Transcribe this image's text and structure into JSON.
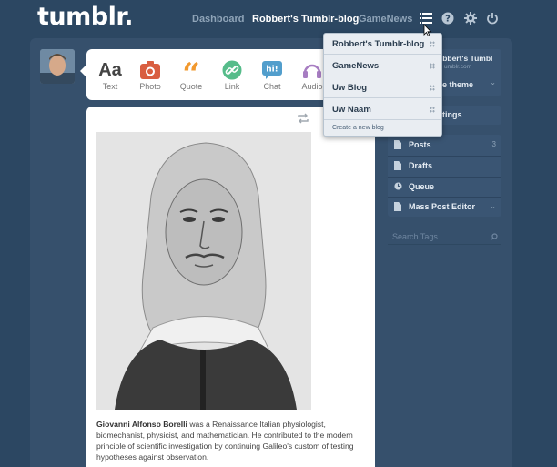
{
  "header": {
    "logo": "tumblr.",
    "nav": {
      "dashboard": "Dashboard",
      "blog_active": "Robbert's Tumblr-blog",
      "gamenews": "GameNews"
    },
    "icons": [
      "list-icon",
      "help-icon",
      "gear-icon",
      "power-icon"
    ]
  },
  "composer": {
    "types": [
      {
        "label": "Text",
        "icon": "text-icon",
        "color": "#444444"
      },
      {
        "label": "Photo",
        "icon": "camera-icon",
        "color": "#d95e40"
      },
      {
        "label": "Quote",
        "icon": "quote-icon",
        "color": "#f2992e"
      },
      {
        "label": "Link",
        "icon": "link-icon",
        "color": "#56bc8a"
      },
      {
        "label": "Chat",
        "icon": "chat-icon",
        "color": "#529ecc"
      },
      {
        "label": "Audio",
        "icon": "headphones-icon",
        "color": "#a77dc2"
      }
    ]
  },
  "post": {
    "caption_name": "Giovanni Alfonso Borelli",
    "caption_text": " was a Renaissance Italian physiologist, biomechanist, physicist, and mathematician. He contributed to the modern principle of scientific investigation by continuing Galileo's custom of testing hypotheses against observation."
  },
  "blog_dropdown": {
    "items": [
      {
        "label": "Robbert's Tumblr-blog"
      },
      {
        "label": "GameNews"
      },
      {
        "label": "Uw Blog"
      },
      {
        "label": "Uw Naam"
      }
    ],
    "create_label": "Create a new blog"
  },
  "sidebar": {
    "blog_name_partial": "obbert's Tumbl",
    "blog_url_partial": "umblr.com",
    "theme_partial": "e theme",
    "settings_partial": "tings",
    "menu": [
      {
        "label": "Posts",
        "count": "3",
        "icon": "document-icon"
      },
      {
        "label": "Drafts",
        "icon": "document-icon"
      },
      {
        "label": "Queue",
        "icon": "clock-icon"
      },
      {
        "label": "Mass Post Editor",
        "icon": "document-icon"
      }
    ],
    "search_placeholder": "Search Tags"
  },
  "colors": {
    "background": "#2c4762",
    "dashboard": "#36506c",
    "sidebar": "#3a5573"
  }
}
